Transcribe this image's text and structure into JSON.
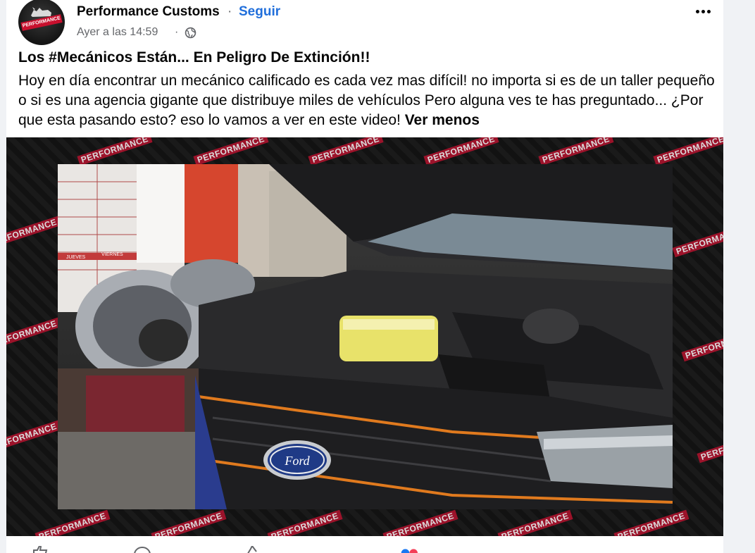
{
  "post": {
    "page_name": "Performance Customs",
    "separator": "·",
    "follow_label": "Seguir",
    "timestamp": "Ayer a las 14:59",
    "timestamp_separator": "·",
    "privacy_icon": "globe-icon",
    "more_icon": "more-options-icon",
    "title": "Los #Mecánicos Están... En Peligro De Extinción!!",
    "body": "Hoy en día encontrar un mecánico calificado es cada vez mas difícil! no importa si es de un taller pequeño o si es una agencia gigante que distribuye miles de vehículos Pero alguna ves te has preguntado... ¿Por que esta pasando esto? eso lo vamos a ver en este video! ",
    "see_less_label": "Ver menos"
  },
  "avatar": {
    "logo_text": "PERFORMANCE"
  },
  "video": {
    "watermark_text": "PERFORMANCE",
    "ford_badge_text": "Ford",
    "board_labels": [
      "JUEVES",
      "VIERNES"
    ]
  },
  "colors": {
    "link_blue": "#216fdb",
    "brand_red": "#c8102e",
    "text_primary": "#050505",
    "text_secondary": "#65676b"
  }
}
